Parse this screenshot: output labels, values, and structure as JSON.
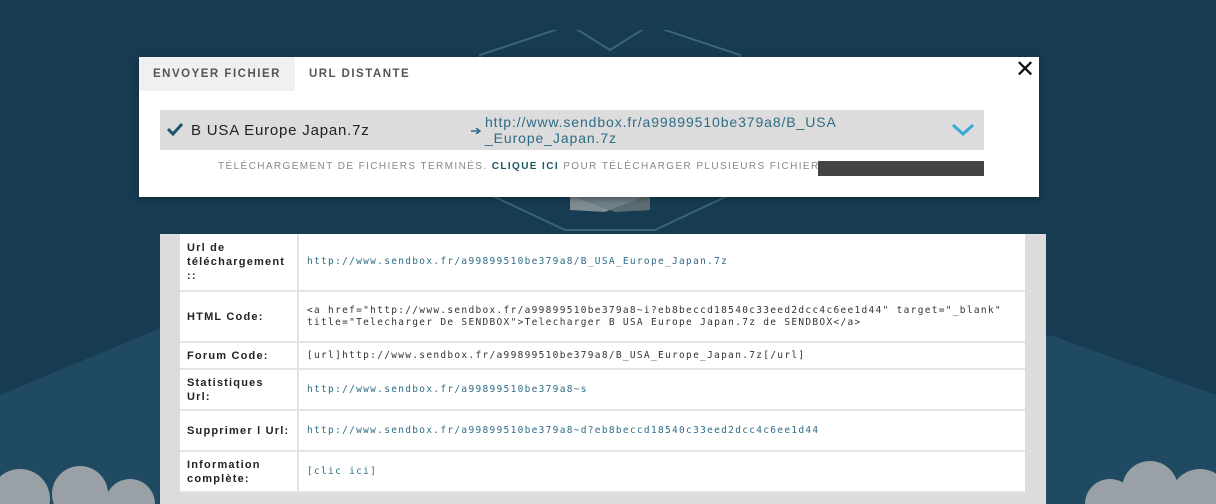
{
  "tabs": [
    {
      "label": "ENVOYER FICHIER",
      "active": true
    },
    {
      "label": "URL DISTANTE",
      "active": false
    }
  ],
  "close_label": "✕",
  "file": {
    "name": "B USA Europe Japan.7z",
    "url": "http://www.sendbox.fr/a99899510be379a8/B_USA_Europe_Japan.7z"
  },
  "status": {
    "prefix": "TÉLÉCHARGEMENT DE FICHIERS TERMINÉS.",
    "click": "CLIQUE ICI",
    "suffix": "POUR TÉLÉCHARGER PLUSIEURS FICHIERS."
  },
  "rows": [
    {
      "label": "Url de téléchargement ::",
      "value": "http://www.sendbox.fr/a99899510be379a8/B_USA_Europe_Japan.7z"
    },
    {
      "label": "HTML Code:",
      "value": "<a href=\"http://www.sendbox.fr/a99899510be379a8~i?eb8beccd18540c33eed2dcc4c6ee1d44\" target=\"_blank\" title=\"Telecharger De SENDBOX\">Telecharger B USA Europe Japan.7z de SENDBOX</a>"
    },
    {
      "label": "Forum Code:",
      "value": "[url]http://www.sendbox.fr/a99899510be379a8/B_USA_Europe_Japan.7z[/url]"
    },
    {
      "label": "Statistiques Url:",
      "value": "http://www.sendbox.fr/a99899510be379a8~s"
    },
    {
      "label": "Supprimer l Url:",
      "value": "http://www.sendbox.fr/a99899510be379a8~d?eb8beccd18540c33eed2dcc4c6ee1d44"
    },
    {
      "label": "Information complète:",
      "value": "[clic ici]"
    }
  ],
  "colors": {
    "background": "#173c52",
    "link": "#2e6c86",
    "accent": "#3da8d8",
    "progress": "#444444"
  },
  "icons": [
    "check-icon",
    "arrow-right-icon",
    "chevron-down-icon",
    "close-icon"
  ]
}
